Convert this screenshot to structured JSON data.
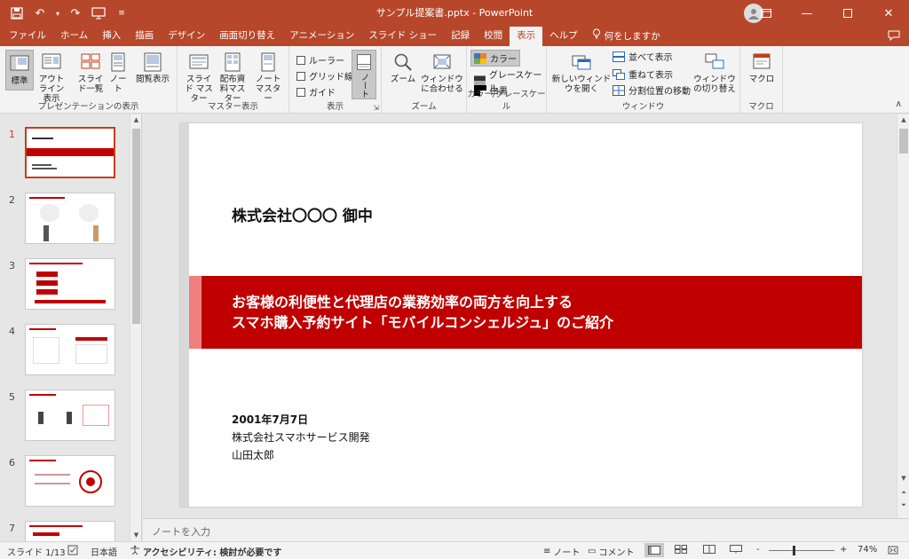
{
  "window": {
    "doc_title": "サンプル提案書.pptx  -  PowerPoint",
    "qat": {
      "save_icon": "save-icon",
      "undo_icon": "undo-icon",
      "redo_icon": "redo-icon",
      "present_icon": "present-from-start-icon"
    },
    "controls": [
      "minimize-icon",
      "maximize-icon",
      "close-icon"
    ]
  },
  "tabs": [
    "ファイル",
    "ホーム",
    "挿入",
    "描画",
    "デザイン",
    "画面切り替え",
    "アニメーション",
    "スライド ショー",
    "記録",
    "校閲",
    "表示",
    "ヘルプ"
  ],
  "tell_me": "何をしますか",
  "ribbon": {
    "presentation_views": {
      "label": "プレゼンテーションの表示",
      "normal": "標準",
      "outline": "アウトライン表示",
      "sorter": "スライド一覧",
      "notes": "ノート",
      "reading": "閲覧表示"
    },
    "master_views": {
      "label": "マスター表示",
      "slide_master": "スライド マスター",
      "handout_master": "配布資料マスター",
      "notes_master": "ノート マスター"
    },
    "show": {
      "label": "表示",
      "ruler": "ルーラー",
      "gridlines": "グリッド線",
      "guides": "ガイド",
      "notes": "ノート"
    },
    "zoom": {
      "label": "ズーム",
      "zoom": "ズーム",
      "fit": "ウィンドウに合わせる"
    },
    "color": {
      "label": "カラー/グレースケール",
      "color": "カラー",
      "grayscale": "グレースケール",
      "bw": "白黒"
    },
    "window": {
      "label": "ウィンドウ",
      "new_window": "新しいウィンドウを開く",
      "arrange": "並べて表示",
      "cascade": "重ねて表示",
      "move_split": "分割位置の移動",
      "switch": "ウィンドウの切り替え"
    },
    "macros": {
      "label": "マクロ",
      "macro": "マクロ"
    }
  },
  "thumbnails": [
    "1",
    "2",
    "3",
    "4",
    "5",
    "6",
    "7"
  ],
  "slide": {
    "recipient": "株式会社〇〇〇 御中",
    "title_line1": "お客様の利便性と代理店の業務効率の両方を向上する",
    "title_line2": "スマホ購入予約サイト「モバイルコンシェルジュ」のご紹介",
    "date": "2001年7月7日",
    "company": "株式会社スマホサービス開発",
    "author": "山田太郎",
    "band_color": "#c00000",
    "accent_color": "#f08080"
  },
  "notes_placeholder": "ノートを入力",
  "status": {
    "slide_count": "スライド 1/13",
    "language": "日本語",
    "accessibility": "アクセシビリティ: 検討が必要です",
    "notes_btn": "ノート",
    "comments_btn": "コメント",
    "zoom_minus": "-",
    "zoom_plus": "+",
    "zoom_level": "74%"
  },
  "colors": {
    "brand": "#b7472a",
    "active_thumb": "#c43e1c"
  }
}
